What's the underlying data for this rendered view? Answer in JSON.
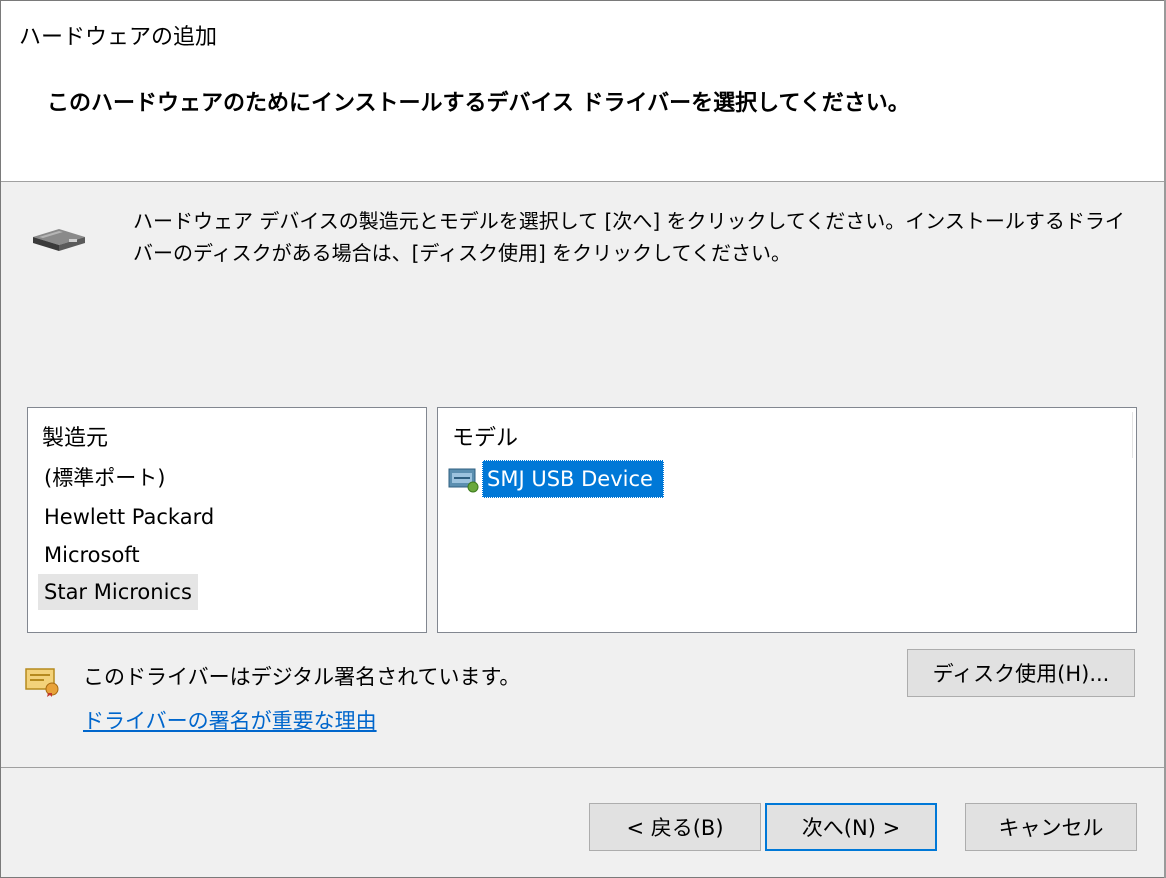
{
  "window": {
    "title": "ハードウェアの追加"
  },
  "header": {
    "heading": "このハードウェアのためにインストールするデバイス ドライバーを選択してください。"
  },
  "intro": {
    "icon": "hardware-device-icon",
    "text": "ハードウェア デバイスの製造元とモデルを選択して [次へ] をクリックしてください。インストールするドライバーのディスクがある場合は、[ディスク使用] をクリックしてください。"
  },
  "manufacturer_list": {
    "header": "製造元",
    "items": [
      {
        "label": "(標準ポート)"
      },
      {
        "label": "Hewlett Packard"
      },
      {
        "label": "Microsoft"
      },
      {
        "label": "Star Micronics"
      }
    ],
    "selected_index": 3
  },
  "model_list": {
    "header": "モデル",
    "items": [
      {
        "label": "SMJ USB Device",
        "icon": "driver-icon"
      }
    ],
    "selected_index": 0
  },
  "signature": {
    "icon": "certificate-icon",
    "text": "このドライバーはデジタル署名されています。",
    "link": "ドライバーの署名が重要な理由"
  },
  "buttons": {
    "have_disk": "ディスク使用(H)...",
    "back": "< 戻る(B)",
    "next": "次へ(N) >",
    "cancel": "キャンセル"
  },
  "colors": {
    "accent": "#0078d7",
    "link": "#0066cc",
    "background": "#f0f0f0",
    "selection_inactive": "#e5e5e5"
  }
}
